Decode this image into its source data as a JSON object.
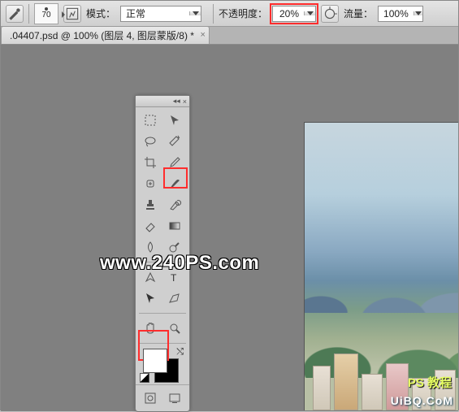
{
  "optionbar": {
    "brush_size": "70",
    "mode_label": "模式：",
    "mode_value": "正常",
    "opacity_label": "不透明度：",
    "opacity_value": "20%",
    "flow_label": "流量：",
    "flow_value": "100%"
  },
  "tab": {
    "title": ".04407.psd @ 100% (图层 4, 图层蒙版/8) *",
    "close": "×"
  },
  "toolpanel": {
    "collapse": "◂◂",
    "close": "×"
  },
  "icons": {
    "tool_current": "brush",
    "panel_toggle": "panel"
  },
  "watermark": {
    "main": "www.240PS.com",
    "corner1": "PS 教程",
    "corner2": "UiBQ.CoM"
  },
  "colors": {
    "highlight": "#ff2d2d",
    "foreground": "#ffffff",
    "background": "#000000"
  }
}
